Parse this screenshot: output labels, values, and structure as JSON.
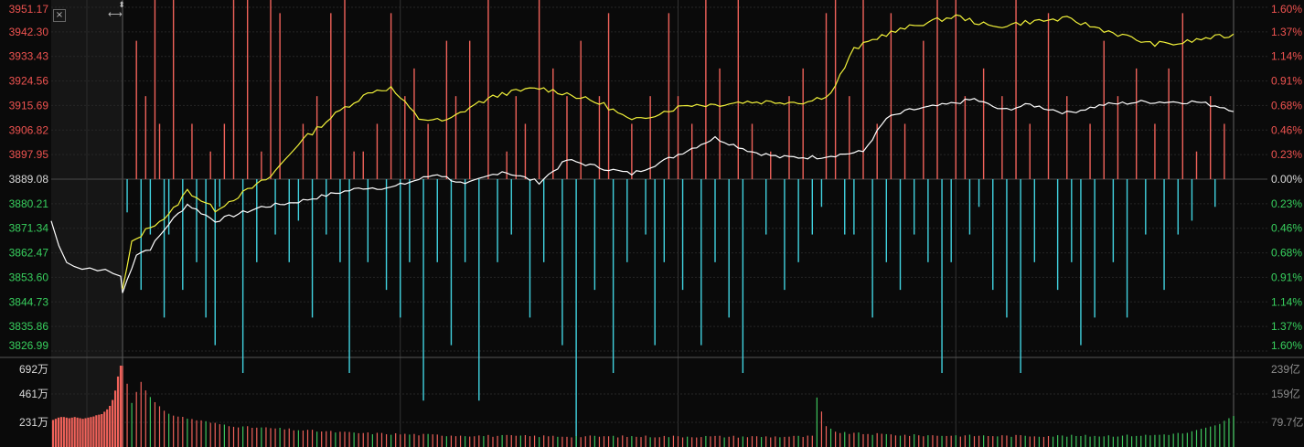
{
  "colors": {
    "background": "#0a0a0a",
    "grid": "#262626",
    "up": "#f0625a",
    "down": "#41d3e0",
    "down_green": "#3ec45c",
    "index_line": "#ffffff",
    "avg_line": "#f2f23a",
    "label_up": "#ef5350",
    "label_mid": "#d9d9d9",
    "label_down": "#38d05e",
    "label_vol": "#d9d9d9",
    "label_amount": "#8c8c8c"
  },
  "controls": {
    "close_icon": "×",
    "resize_icon": "⟷",
    "drag_icon": "⬍"
  },
  "chart_data": [
    {
      "type": "line",
      "name": "intraday-price",
      "price_axis": [
        "3951.17",
        "3942.30",
        "3933.43",
        "3924.56",
        "3915.69",
        "3906.82",
        "3897.95",
        "3889.08",
        "3880.21",
        "3871.34",
        "3862.47",
        "3853.60",
        "3844.73",
        "3835.86",
        "3826.99"
      ],
      "pct_axis": [
        "1.60%",
        "1.37%",
        "1.14%",
        "0.91%",
        "0.68%",
        "0.46%",
        "0.23%",
        "0.00%",
        "0.23%",
        "0.46%",
        "0.68%",
        "0.91%",
        "1.14%",
        "1.37%",
        "1.60%"
      ],
      "ylim": [
        3826.99,
        3951.17
      ],
      "baseline": 3889.08,
      "pre_session_points": 10,
      "session_points": 241,
      "series": [
        {
          "role": "white",
          "pre": [
            3874,
            3865,
            3859,
            3857.5,
            3856.5,
            3857,
            3856,
            3856.5,
            3855,
            3854
          ],
          "knots": [
            [
              0,
              3848
            ],
            [
              3,
              3862
            ],
            [
              6,
              3864
            ],
            [
              10,
              3873
            ],
            [
              14,
              3880
            ],
            [
              20,
              3874
            ],
            [
              30,
              3879
            ],
            [
              38,
              3881
            ],
            [
              46,
              3884
            ],
            [
              52,
              3886
            ],
            [
              58,
              3886
            ],
            [
              62,
              3888
            ],
            [
              68,
              3891
            ],
            [
              74,
              3887
            ],
            [
              82,
              3892
            ],
            [
              90,
              3888
            ],
            [
              96,
              3896
            ],
            [
              104,
              3893
            ],
            [
              110,
              3891
            ],
            [
              116,
              3895
            ],
            [
              120,
              3898
            ],
            [
              128,
              3904
            ],
            [
              136,
              3899
            ],
            [
              142,
              3897
            ],
            [
              150,
              3897
            ],
            [
              160,
              3899
            ],
            [
              165,
              3911
            ],
            [
              170,
              3914
            ],
            [
              178,
              3916
            ],
            [
              184,
              3918
            ],
            [
              190,
              3914
            ],
            [
              196,
              3916
            ],
            [
              204,
              3913
            ],
            [
              212,
              3916
            ],
            [
              220,
              3917
            ],
            [
              226,
              3917
            ],
            [
              232,
              3917
            ],
            [
              238,
              3915
            ],
            [
              240,
              3914
            ]
          ]
        },
        {
          "role": "yellow",
          "knots": [
            [
              0,
              3849
            ],
            [
              2,
              3866
            ],
            [
              6,
              3872
            ],
            [
              10,
              3876
            ],
            [
              14,
              3885
            ],
            [
              20,
              3878
            ],
            [
              26,
              3884
            ],
            [
              32,
              3890
            ],
            [
              38,
              3902
            ],
            [
              44,
              3910
            ],
            [
              48,
              3915
            ],
            [
              54,
              3921
            ],
            [
              58,
              3922
            ],
            [
              64,
              3911
            ],
            [
              70,
              3910
            ],
            [
              76,
              3916
            ],
            [
              82,
              3920
            ],
            [
              90,
              3922
            ],
            [
              96,
              3920
            ],
            [
              104,
              3916
            ],
            [
              110,
              3910
            ],
            [
              116,
              3913
            ],
            [
              122,
              3916
            ],
            [
              128,
              3916
            ],
            [
              134,
              3917
            ],
            [
              140,
              3917
            ],
            [
              148,
              3917
            ],
            [
              153,
              3920
            ],
            [
              158,
              3936
            ],
            [
              164,
              3941
            ],
            [
              172,
              3945
            ],
            [
              180,
              3948
            ],
            [
              188,
              3944
            ],
            [
              196,
              3946
            ],
            [
              204,
              3947
            ],
            [
              214,
              3942
            ],
            [
              222,
              3938
            ],
            [
              228,
              3938
            ],
            [
              234,
              3940
            ],
            [
              240,
              3941
            ]
          ]
        }
      ],
      "change_bars": [
        {
          "role": "up",
          "bars": [
            [
              3,
              5
            ],
            [
              5,
              3
            ],
            [
              7,
              9
            ],
            [
              8,
              2
            ],
            [
              11,
              8
            ],
            [
              15,
              2
            ],
            [
              19,
              1
            ],
            [
              22,
              2
            ],
            [
              24,
              11
            ],
            [
              27,
              9
            ],
            [
              30,
              1
            ],
            [
              32,
              11
            ],
            [
              34,
              6
            ],
            [
              39,
              2
            ],
            [
              42,
              3
            ],
            [
              45,
              6
            ],
            [
              48,
              7
            ],
            [
              50,
              1
            ],
            [
              52,
              1
            ],
            [
              55,
              2
            ],
            [
              58,
              6
            ],
            [
              61,
              3
            ],
            [
              63,
              4
            ],
            [
              66,
              2
            ],
            [
              70,
              5
            ],
            [
              72,
              3
            ],
            [
              75,
              5
            ],
            [
              79,
              7
            ],
            [
              83,
              1
            ],
            [
              85,
              3
            ],
            [
              87,
              2
            ],
            [
              90,
              10
            ],
            [
              93,
              4
            ],
            [
              96,
              3
            ],
            [
              99,
              5
            ],
            [
              103,
              3
            ],
            [
              105,
              6
            ],
            [
              110,
              2
            ],
            [
              114,
              3
            ],
            [
              118,
              6
            ],
            [
              120,
              3
            ],
            [
              123,
              2
            ],
            [
              126,
              7
            ],
            [
              129,
              4
            ],
            [
              133,
              9
            ],
            [
              136,
              2
            ],
            [
              140,
              1
            ],
            [
              144,
              3
            ],
            [
              147,
              4
            ],
            [
              152,
              6
            ],
            [
              154,
              8
            ],
            [
              157,
              3
            ],
            [
              160,
              7
            ],
            [
              163,
              2
            ],
            [
              166,
              6
            ],
            [
              169,
              2
            ],
            [
              173,
              5
            ],
            [
              176,
              8
            ],
            [
              180,
              10
            ],
            [
              182,
              3
            ],
            [
              186,
              4
            ],
            [
              190,
              3
            ],
            [
              193,
              7
            ],
            [
              196,
              2
            ],
            [
              200,
              6
            ],
            [
              204,
              3
            ],
            [
              209,
              2
            ],
            [
              212,
              5
            ],
            [
              215,
              3
            ],
            [
              219,
              4
            ],
            [
              223,
              2
            ],
            [
              226,
              4
            ],
            [
              229,
              6
            ],
            [
              232,
              1
            ],
            [
              235,
              3
            ],
            [
              238,
              2
            ]
          ]
        },
        {
          "role": "down",
          "bars": [
            [
              1,
              -1.2
            ],
            [
              4,
              -4
            ],
            [
              6,
              -2
            ],
            [
              9,
              -5
            ],
            [
              10,
              -2
            ],
            [
              13,
              -4
            ],
            [
              16,
              -3
            ],
            [
              18,
              -5
            ],
            [
              20,
              -6
            ],
            [
              21,
              -1
            ],
            [
              26,
              -7
            ],
            [
              29,
              -3
            ],
            [
              33,
              -2
            ],
            [
              36,
              -3
            ],
            [
              38,
              -1.5
            ],
            [
              41,
              -5
            ],
            [
              44,
              -2
            ],
            [
              47,
              -3
            ],
            [
              49,
              -7
            ],
            [
              53,
              -3
            ],
            [
              57,
              -4
            ],
            [
              60,
              -5
            ],
            [
              62,
              -3
            ],
            [
              65,
              -8
            ],
            [
              68,
              -3
            ],
            [
              71,
              -6
            ],
            [
              74,
              -3
            ],
            [
              77,
              -8
            ],
            [
              81,
              -3
            ],
            [
              84,
              -2
            ],
            [
              88,
              -5
            ],
            [
              91,
              -3
            ],
            [
              95,
              -6
            ],
            [
              98,
              -10
            ],
            [
              102,
              -4
            ],
            [
              106,
              -7
            ],
            [
              109,
              -3
            ],
            [
              113,
              -2
            ],
            [
              115,
              -6
            ],
            [
              117,
              -3
            ],
            [
              121,
              -4
            ],
            [
              125,
              -6
            ],
            [
              128,
              -3
            ],
            [
              131,
              -5
            ],
            [
              134,
              -7
            ],
            [
              139,
              -2
            ],
            [
              143,
              -4
            ],
            [
              146,
              -3
            ],
            [
              149,
              -2
            ],
            [
              151,
              -1
            ],
            [
              156,
              -2
            ],
            [
              158,
              -2
            ],
            [
              162,
              -5
            ],
            [
              165,
              -3
            ],
            [
              168,
              -4
            ],
            [
              171,
              -2
            ],
            [
              174,
              -3
            ],
            [
              177,
              -7
            ],
            [
              179,
              -3
            ],
            [
              183,
              -2
            ],
            [
              185,
              -1
            ],
            [
              188,
              -4
            ],
            [
              191,
              -5
            ],
            [
              194,
              -7
            ],
            [
              197,
              -3
            ],
            [
              202,
              -4
            ],
            [
              205,
              -3
            ],
            [
              207,
              -6
            ],
            [
              210,
              -5
            ],
            [
              214,
              -3
            ],
            [
              217,
              -5
            ],
            [
              221,
              -2
            ],
            [
              225,
              -4
            ],
            [
              228,
              -2
            ],
            [
              231,
              -1.5
            ],
            [
              236,
              -1
            ]
          ]
        }
      ],
      "units_per_percent_note": ""
    },
    {
      "type": "bar",
      "name": "volume",
      "left_axis": [
        "692万",
        "461万",
        "231万"
      ],
      "right_axis": [
        "239亿",
        "159亿",
        "79.7亿"
      ],
      "ylim": [
        0,
        692
      ],
      "pre_volumes": [
        230,
        240,
        250,
        255,
        255,
        250,
        245,
        250,
        255,
        250,
        245,
        240,
        245,
        250,
        255,
        260,
        270,
        275,
        280,
        300,
        320,
        350,
        400,
        480,
        600,
        692
      ],
      "session_volumes_knots": [
        [
          0,
          692
        ],
        [
          2,
          380
        ],
        [
          4,
          560
        ],
        [
          6,
          420
        ],
        [
          9,
          300
        ],
        [
          12,
          260
        ],
        [
          16,
          230
        ],
        [
          20,
          200
        ],
        [
          26,
          170
        ],
        [
          32,
          160
        ],
        [
          40,
          140
        ],
        [
          50,
          120
        ],
        [
          60,
          110
        ],
        [
          70,
          100
        ],
        [
          80,
          95
        ],
        [
          100,
          90
        ],
        [
          120,
          90
        ],
        [
          140,
          88
        ],
        [
          149,
          90
        ],
        [
          150,
          420
        ],
        [
          152,
          170
        ],
        [
          155,
          120
        ],
        [
          170,
          100
        ],
        [
          190,
          95
        ],
        [
          210,
          95
        ],
        [
          222,
          100
        ],
        [
          230,
          120
        ],
        [
          236,
          180
        ],
        [
          240,
          260
        ]
      ]
    }
  ]
}
